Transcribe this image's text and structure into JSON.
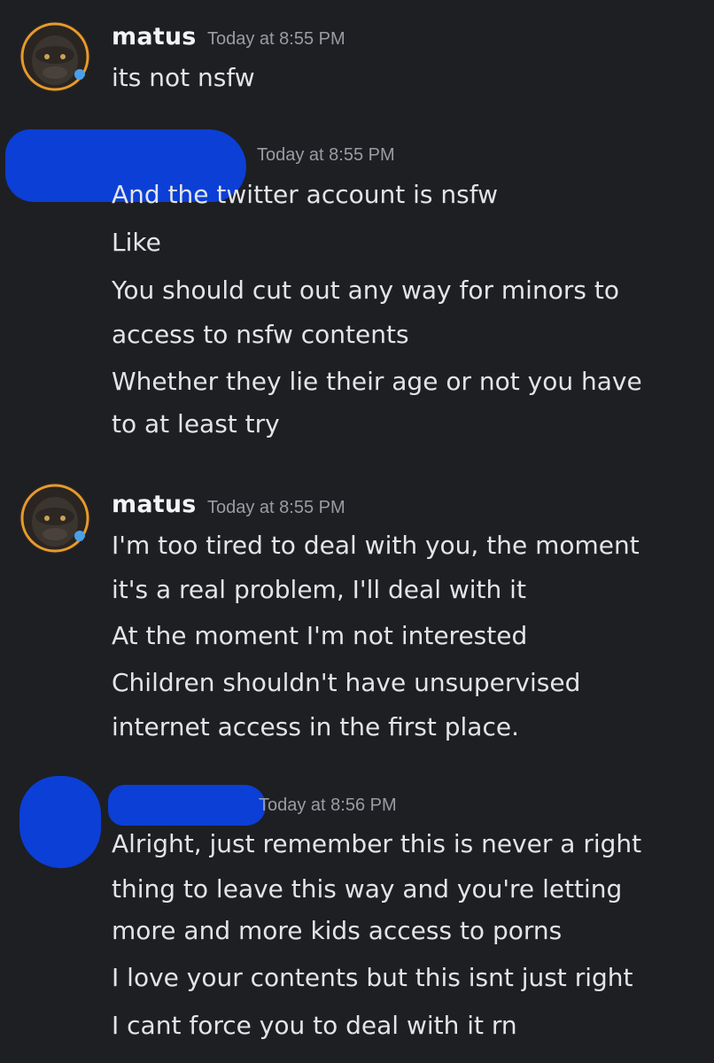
{
  "messages": [
    {
      "author": "matus",
      "timestamp": "Today at 8:55 PM",
      "lines": [
        "its not nsfw"
      ]
    },
    {
      "author": "",
      "timestamp": "Today at 8:55 PM",
      "lines": [
        "And the twitter account is nsfw",
        "Like",
        "You should cut out any way for minors to",
        "access to nsfw contents",
        "Whether they lie their age or not you have",
        "to at least try"
      ]
    },
    {
      "author": "matus",
      "timestamp": "Today at 8:55 PM",
      "lines": [
        "I'm too tired to deal with you, the moment",
        "it's a real problem, I'll deal with it",
        "At the moment I'm not interested",
        "Children shouldn't have unsupervised",
        "internet access in the first place."
      ]
    },
    {
      "author": "",
      "timestamp": "Today at 8:56 PM",
      "lines": [
        "Alright, just remember this is never a right",
        "thing to leave this way and you're letting",
        "more and more kids access to porns",
        "I love your contents but this isnt just right",
        "I cant force you to deal with it rn"
      ]
    }
  ],
  "colors": {
    "background": "#1e1f23",
    "redaction": "#0b3fd6",
    "timestamp": "#9a9ca3",
    "text": "#e3e4e6"
  }
}
